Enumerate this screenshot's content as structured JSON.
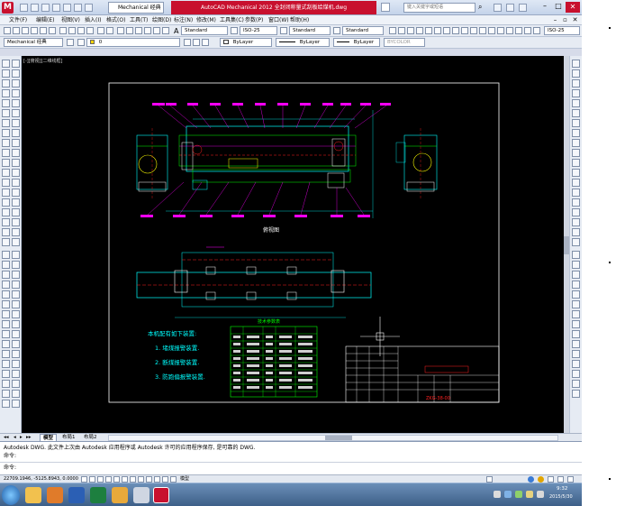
{
  "app": {
    "title": "AutoCAD Mechanical 2012   全封闭称量式刮板给煤机.dwg",
    "workspace": "Mechanical 经典",
    "app_icon_letter": "M",
    "search_placeholder": "键入关键字或短语"
  },
  "menu": [
    "文件(F)",
    "编辑(E)",
    "视图(V)",
    "插入(I)",
    "格式(O)",
    "工具(T)",
    "绘图(D)",
    "标注(N)",
    "修改(M)",
    "工具集(C)",
    "参数(P)",
    "窗口(W)",
    "帮助(H)"
  ],
  "toolbar1": {
    "text_style": "Standard",
    "dim_style": "ISO-25",
    "table_style": "Standard",
    "mleader_style": "Standard",
    "mech_dim_style": "ISO-25"
  },
  "toolbar2": {
    "workspace": "Mechanical 经典",
    "layer": "0",
    "color": "ByLayer",
    "linetype": "ByLayer",
    "lineweight": "ByLayer",
    "plotstyle": "BYCOLOR"
  },
  "viewport_label": "[-][俯视][二维线框]",
  "drawing": {
    "section_title": "俯视图",
    "notes_title": "本机配有如下装置:",
    "notes": [
      "1. 堵煤报警装置.",
      "2. 断煤报警装置.",
      "3. 防跑偏报警装置."
    ],
    "table_title": "技术参数表",
    "title_block_code": "ZKG-38-00"
  },
  "layout_tabs": [
    "模型",
    "布局1",
    "布局2"
  ],
  "command": {
    "history": "Autodesk DWG.  此文件上次由 Autodesk 应用程序或 Autodesk 许可的应用程序保存, 是可靠的 DWG.",
    "prompt1": "命令:",
    "prompt2": "命令:"
  },
  "status": {
    "coords": "22709.1946, -5125.8943, 0.0000",
    "mode": "模型"
  },
  "taskbar": {
    "time": "9:32",
    "date": "2015/5/30"
  },
  "colors": {
    "title_red": "#c8102e",
    "canvas_bg": "#000000",
    "cyan": "#00ffff",
    "magenta": "#ff00ff",
    "green": "#00ff00",
    "red": "#ff2020",
    "yellow": "#ffff00",
    "white": "#ffffff"
  }
}
